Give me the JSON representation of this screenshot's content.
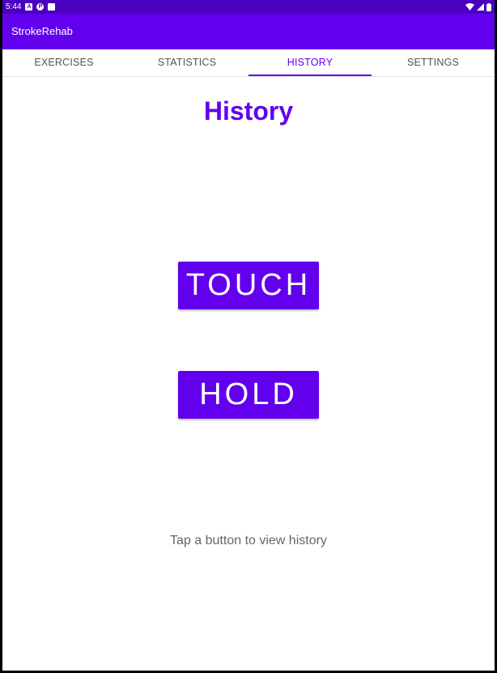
{
  "status_bar": {
    "time": "5:44",
    "left_icons": [
      "notification-a-icon",
      "notification-b-icon",
      "sd-card-icon"
    ],
    "right_icons": [
      "wifi-icon",
      "signal-icon",
      "battery-icon"
    ]
  },
  "app_bar": {
    "title": "StrokeRehab"
  },
  "tabs": [
    {
      "label": "EXERCISES",
      "active": false
    },
    {
      "label": "STATISTICS",
      "active": false
    },
    {
      "label": "HISTORY",
      "active": true
    },
    {
      "label": "SETTINGS",
      "active": false
    }
  ],
  "main": {
    "title": "History",
    "touch_button": "TOUCH",
    "hold_button": "HOLD",
    "hint": "Tap a button to view history"
  },
  "colors": {
    "primary": "#6200ee",
    "status_bar": "#4a00bf",
    "text_secondary": "#666666"
  }
}
